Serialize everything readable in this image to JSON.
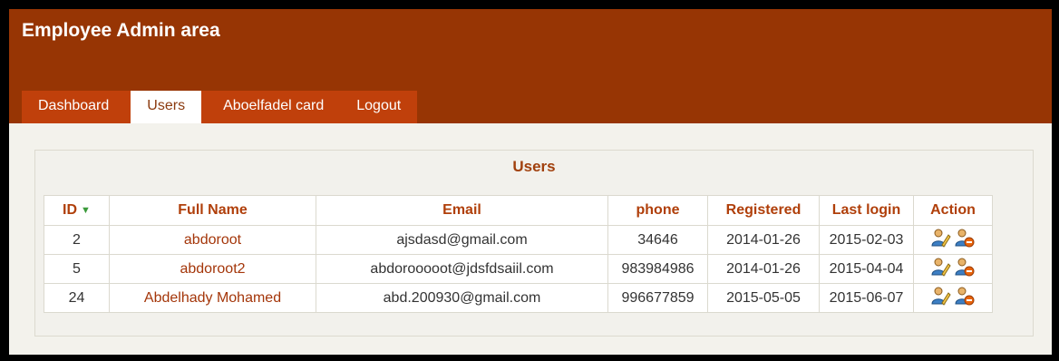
{
  "app": {
    "title": "Employee Admin area"
  },
  "nav": {
    "tabs": [
      {
        "label": "Dashboard"
      },
      {
        "label": "Users"
      },
      {
        "label": "Aboelfadel card"
      },
      {
        "label": "Logout"
      }
    ],
    "active_index": 1
  },
  "users": {
    "title": "Users",
    "columns": [
      "ID",
      "Full Name",
      "Email",
      "phone",
      "Registered",
      "Last login",
      "Action"
    ],
    "sort_icon": "sort-down-arrow-icon",
    "action_icons": [
      "edit-user-icon",
      "delete-user-icon"
    ],
    "rows": [
      {
        "id": "2",
        "name": "abdoroot",
        "email": "ajsdasd@gmail.com",
        "phone": "34646",
        "registered": "2014-01-26",
        "last_login": "2015-02-03"
      },
      {
        "id": "5",
        "name": "abdoroot2",
        "email": "abdorooooot@jdsfdsaiil.com",
        "phone": "983984986",
        "registered": "2014-01-26",
        "last_login": "2015-04-04"
      },
      {
        "id": "24",
        "name": "Abdelhady Mohamed",
        "email": "abd.200930@gmail.com",
        "phone": "996677859",
        "registered": "2015-05-05",
        "last_login": "2015-06-07"
      }
    ]
  },
  "colors": {
    "header_bg": "#973504",
    "tab_bar_bg": "#c0400b",
    "accent_text": "#a1400d",
    "page_bg": "#f3f2ec"
  }
}
